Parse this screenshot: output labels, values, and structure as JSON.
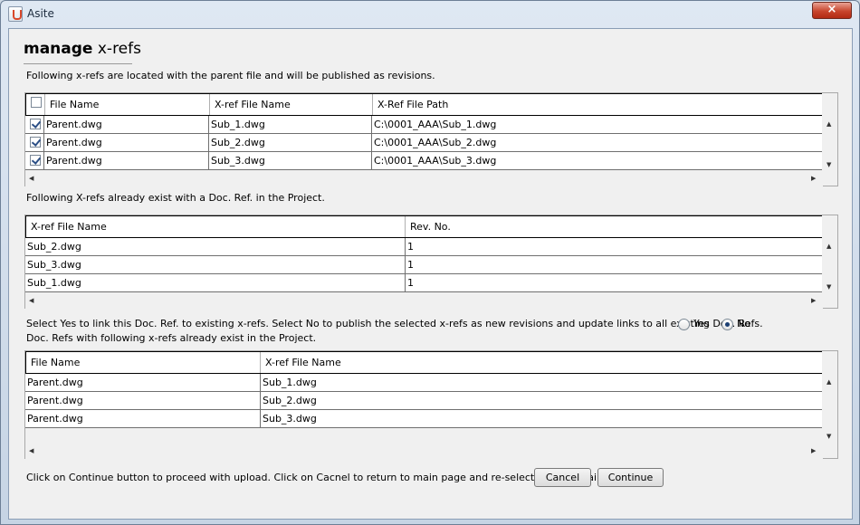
{
  "window": {
    "title": "Asite",
    "close_glyph": "×"
  },
  "heading": {
    "bold": "manage",
    "rest": "x-refs"
  },
  "section1": {
    "caption": "Following x-refs are located with the parent file and will be published as revisions.",
    "columns": [
      "File Name",
      "X-ref File Name",
      "X-Ref File Path"
    ],
    "rows": [
      {
        "checked": true,
        "file_name": "Parent.dwg",
        "xref_name": "Sub_1.dwg",
        "path": "C:\\0001_AAA\\Sub_1.dwg"
      },
      {
        "checked": true,
        "file_name": "Parent.dwg",
        "xref_name": "Sub_2.dwg",
        "path": "C:\\0001_AAA\\Sub_2.dwg"
      },
      {
        "checked": true,
        "file_name": "Parent.dwg",
        "xref_name": "Sub_3.dwg",
        "path": "C:\\0001_AAA\\Sub_3.dwg"
      }
    ]
  },
  "section2": {
    "caption": "Following X-refs already exist with a Doc. Ref. in the Project.",
    "columns": [
      "X-ref File Name",
      "Rev. No."
    ],
    "rows": [
      {
        "xref_name": "Sub_2.dwg",
        "rev": "1"
      },
      {
        "xref_name": "Sub_3.dwg",
        "rev": "1"
      },
      {
        "xref_name": "Sub_1.dwg",
        "rev": "1"
      }
    ]
  },
  "link_choice": {
    "prompt": "Select Yes to link this Doc. Ref. to existing x-refs. Select No to publish the selected x-refs as new revisions and update links to all existing Doc. Refs.",
    "yes_label": "Yes",
    "no_label": "No",
    "selected": "No"
  },
  "section3": {
    "caption": "Doc. Refs with following x-refs already exist in the Project.",
    "columns": [
      "File Name",
      "X-ref File Name"
    ],
    "rows": [
      {
        "file_name": "Parent.dwg",
        "xref_name": "Sub_1.dwg"
      },
      {
        "file_name": "Parent.dwg",
        "xref_name": "Sub_2.dwg"
      },
      {
        "file_name": "Parent.dwg",
        "xref_name": "Sub_3.dwg"
      }
    ]
  },
  "footer": {
    "instruction": "Click on Continue button to proceed with upload. Click on Cacnel to return to main page and re-select the file again.",
    "cancel_label": "Cancel",
    "continue_label": "Continue"
  },
  "glyphs": {
    "up": "▲",
    "down": "▼",
    "left": "◀",
    "right": "▶"
  }
}
